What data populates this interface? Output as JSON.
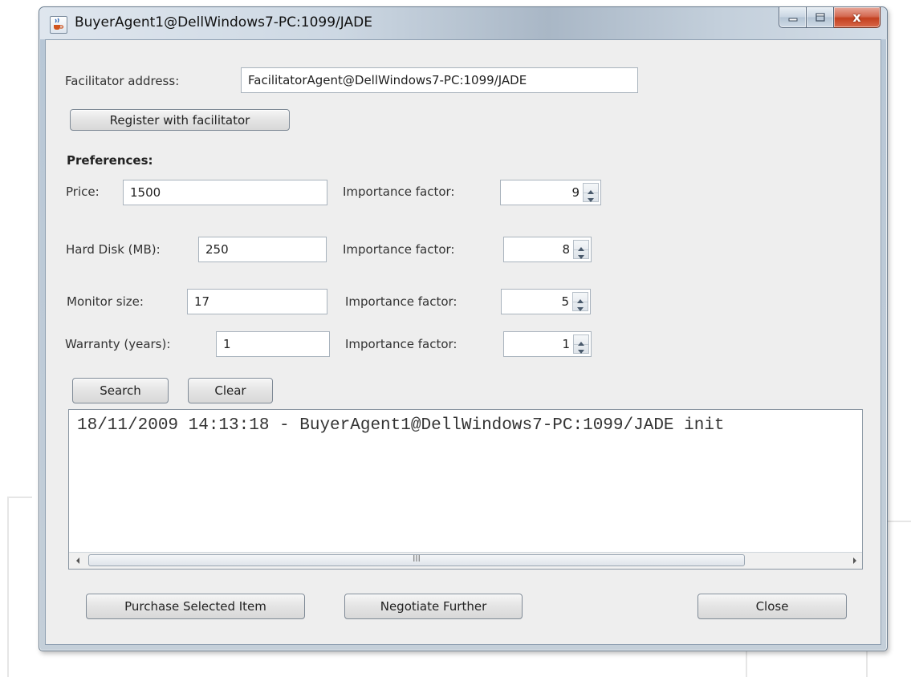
{
  "window": {
    "title": "BuyerAgent1@DellWindows7-PC:1099/JADE",
    "close_glyph": "x"
  },
  "facilitator": {
    "label": "Facilitator address:",
    "value": "FacilitatorAgent@DellWindows7-PC:1099/JADE",
    "register_button": "Register with facilitator"
  },
  "preferences": {
    "heading": "Preferences:",
    "rows": [
      {
        "label": "Price:",
        "value": "1500",
        "importance_label": "Importance factor:",
        "importance": "9"
      },
      {
        "label": "Hard Disk (MB):",
        "value": "250",
        "importance_label": "Importance factor:",
        "importance": "8"
      },
      {
        "label": "Monitor size:",
        "value": "17",
        "importance_label": "Importance factor:",
        "importance": "5"
      },
      {
        "label": "Warranty (years):",
        "value": "1",
        "importance_label": "Importance factor:",
        "importance": "1"
      }
    ]
  },
  "actions": {
    "search": "Search",
    "clear": "Clear"
  },
  "log": {
    "line": "18/11/2009 14:13:18 - BuyerAgent1@DellWindows7-PC:1099/JADE init",
    "grip_glyph": "III"
  },
  "footer": {
    "purchase": "Purchase Selected Item",
    "negotiate": "Negotiate Further",
    "close": "Close"
  },
  "colors": {
    "client_bg": "#eeeeee",
    "close_button": "#c3401f",
    "titlebar": "#cdd8e3"
  },
  "icons": {
    "app": "java-cup-icon",
    "minimize": "minimize-icon",
    "maximize": "maximize-icon",
    "close": "close-icon",
    "spin_up": "spin-up-icon",
    "spin_down": "spin-down-icon",
    "scroll_left": "scroll-left-icon",
    "scroll_right": "scroll-right-icon"
  }
}
